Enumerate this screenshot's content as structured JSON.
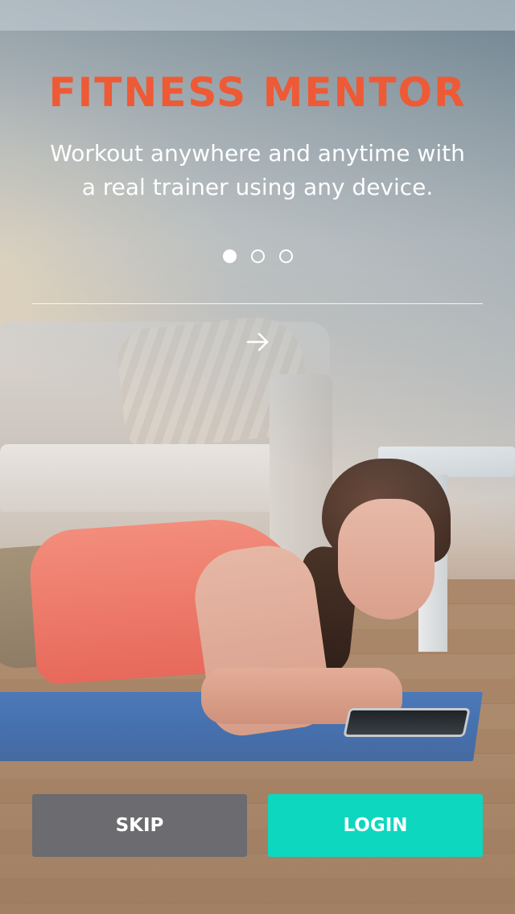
{
  "app": {
    "title": "Fitness Mentor",
    "subtitle": "Workout anywhere and anytime with a real trainer using any device."
  },
  "pager": {
    "pages": 3,
    "current": 1
  },
  "navigation": {
    "next_icon": "arrow-right-icon"
  },
  "actions": {
    "skip_label": "SKIP",
    "login_label": "LOGIN"
  },
  "colors": {
    "title": "#ee5a35",
    "skip_button": "#6b6b70",
    "login_button": "#0dd7bf",
    "text": "#ffffff"
  },
  "background_image": "woman-doing-plank-with-tablet-in-living-room"
}
